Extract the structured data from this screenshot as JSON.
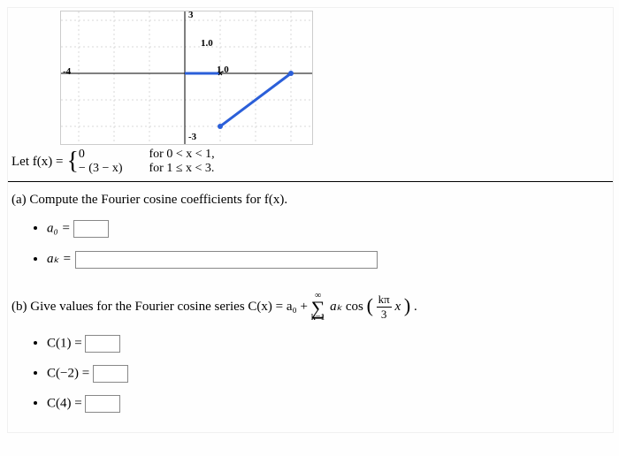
{
  "graph": {
    "xmin_label": "-4",
    "ytick_label": "1.0",
    "ytitle": "3",
    "xtick_label": "1.0",
    "ymin_label": "-3"
  },
  "fdef": {
    "lhs": "Let f(x) = ",
    "case1_expr": "0",
    "case1_cond": "for  0 < x < 1,",
    "case2_expr": "− (3 − x)",
    "case2_cond": "for  1 ≤ x < 3."
  },
  "part_a": {
    "prompt": "(a) Compute the Fourier cosine coefficients for f(x).",
    "a0_label": "a₀ =",
    "ak_label": "aₖ ="
  },
  "part_b": {
    "prefix": "(b) Give values for the Fourier cosine series ",
    "series_lhs": "C(x) = a₀ + ",
    "series_upper": "∞",
    "series_lower": "k=1",
    "coef": "aₖ",
    "costxt": " cos",
    "frac_num": "kπ",
    "frac_den": "3",
    "xvar": " x",
    "tail": ".",
    "c1": "C(1) =",
    "cminus2": "C(−2) =",
    "c4": "C(4) ="
  }
}
